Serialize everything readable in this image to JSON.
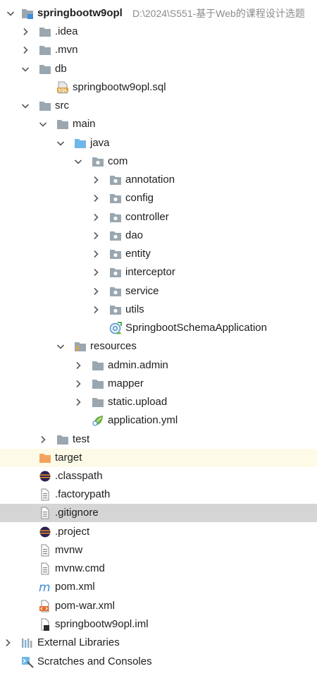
{
  "project": {
    "name": "springbootw9opl",
    "path": "D:\\2024\\S551-基于Web的课程设计选题"
  },
  "tree": {
    "idea": ".idea",
    "mvn": ".mvn",
    "db": "db",
    "db_sql": "springbootw9opl.sql",
    "src": "src",
    "main": "main",
    "java": "java",
    "com": "com",
    "annotation": "annotation",
    "config": "config",
    "controller": "controller",
    "dao": "dao",
    "entity": "entity",
    "interceptor": "interceptor",
    "service": "service",
    "utils": "utils",
    "app_class": "SpringbootSchemaApplication",
    "resources": "resources",
    "admin": "admin.admin",
    "mapper": "mapper",
    "static_upload": "static.upload",
    "app_yml": "application.yml",
    "test": "test",
    "target": "target",
    "classpath": ".classpath",
    "factorypath": ".factorypath",
    "gitignore": ".gitignore",
    "project_file": ".project",
    "mvnw": "mvnw",
    "mvnw_cmd": "mvnw.cmd",
    "pom": "pom.xml",
    "pom_war": "pom-war.xml",
    "iml": "springbootw9opl.iml",
    "external_libraries": "External Libraries",
    "scratches": "Scratches and Consoles"
  },
  "colors": {
    "selected_row": "#d5d5d5",
    "excluded_row": "#fdfbe8",
    "folder_gray": "#9aa7b0",
    "source_folder_blue": "#6fb7e8",
    "excluded_folder_orange": "#f4a35f",
    "module_blue": "#3d8ede"
  }
}
